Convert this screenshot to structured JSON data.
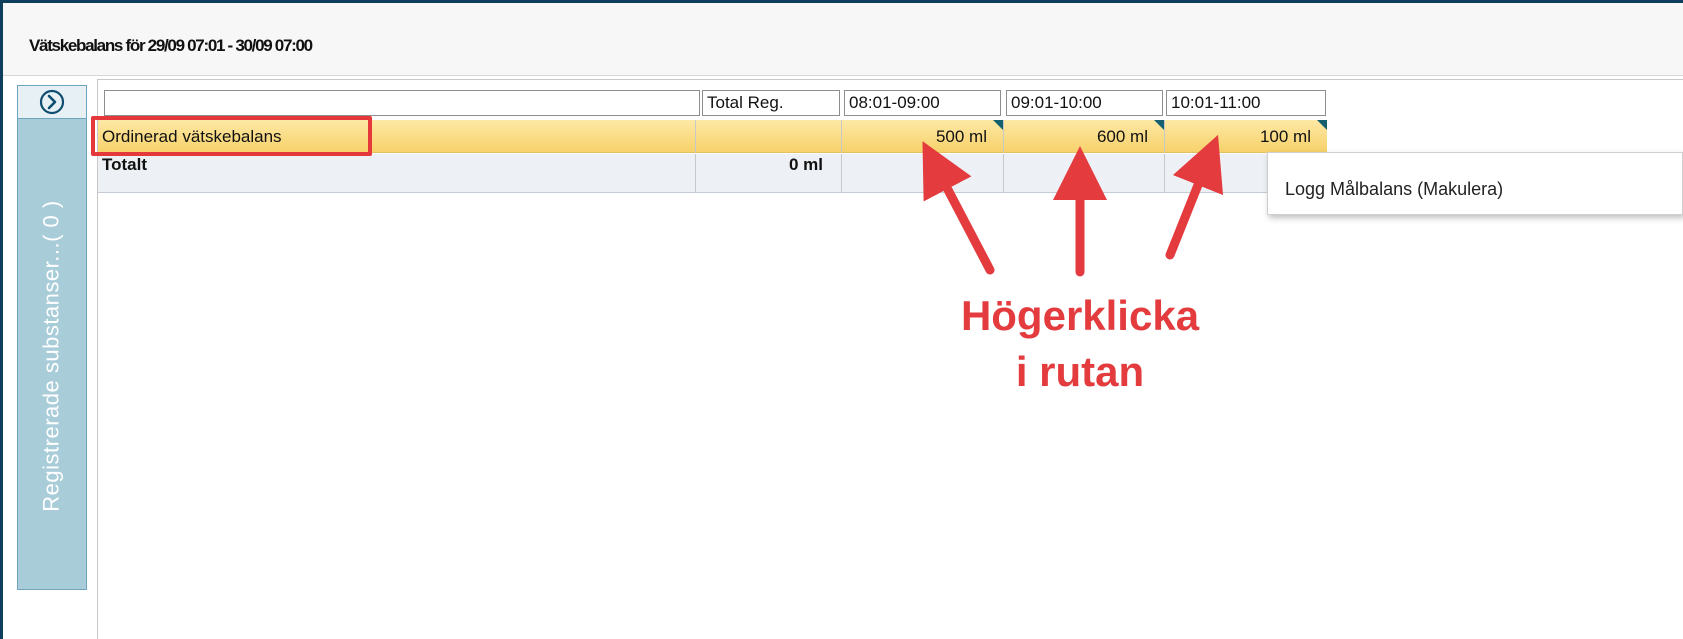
{
  "window": {
    "title": "Vätskebalans för 29/09 07:01 - 30/09 07:00"
  },
  "sidepanel": {
    "toggle_icon": "chevron-right-circle-icon",
    "label": "Registrerade substanser...( 0 )"
  },
  "table": {
    "columns": [
      "",
      "Total Reg.",
      "08:01-09:00",
      "09:01-10:00",
      "10:01-11:00"
    ],
    "rows": [
      {
        "label": "Ordinerad vätskebalans",
        "total": "",
        "values": [
          "500 ml",
          "600 ml",
          "100 ml"
        ]
      },
      {
        "label": "Totalt",
        "total": "0 ml",
        "values": [
          "",
          "",
          ""
        ]
      }
    ]
  },
  "context_menu": {
    "items": [
      "Logg Målbalans (Makulera)"
    ]
  },
  "annotation": {
    "line1": "Högerklicka",
    "line2": "i rutan",
    "color": "#e33b3e"
  },
  "colors": {
    "frame_border": "#0f3d5c",
    "sidepanel_bg": "#a9ccd9",
    "row_highlight": "#f7d26b",
    "cell_marker": "#14606e"
  }
}
